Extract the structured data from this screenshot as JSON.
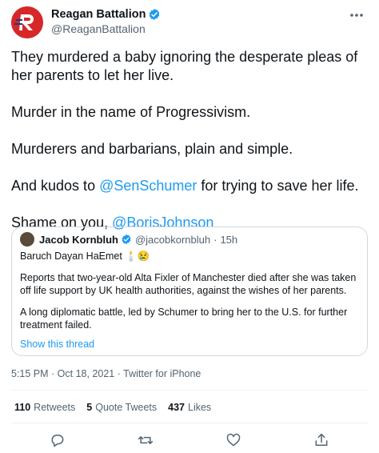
{
  "author": {
    "display_name": "Reagan Battalion",
    "handle": "@ReaganBattalion",
    "avatar_icon": "reagan-battalion-logo"
  },
  "tweet": {
    "p1": "They murdered a baby ignoring the desperate pleas of her parents to let her live.",
    "p2": "Murder in the name of Progressivism.",
    "p3": "Murderers and barbarians, plain and simple.",
    "p4_before": "And kudos to ",
    "p4_mention": "@SenSchumer",
    "p4_after": " for trying to save her life.",
    "p5_before": "Shame on you, ",
    "p5_mention": "@BorisJohnson"
  },
  "quote": {
    "display_name": "Jacob Kornbluh",
    "handle": "@jacobkornbluh",
    "separator": "·",
    "time": "15h",
    "line1": "Baruch Dayan HaEmet 🕯️😢",
    "para1": "Reports that two-year-old Alta Fixler of Manchester died after she was taken off life support by UK health authorities, against the wishes of her parents.",
    "para2": "A long diplomatic battle, led by Schumer to bring her to the U.S. for further treatment failed.",
    "show_thread": "Show this thread"
  },
  "meta": {
    "timestamp": "5:15 PM · Oct 18, 2021 · Twitter for iPhone"
  },
  "stats": {
    "retweets_count": "110",
    "retweets_label": "Retweets",
    "quotes_count": "5",
    "quotes_label": "Quote Tweets",
    "likes_count": "437",
    "likes_label": "Likes"
  },
  "actions": [
    "reply-icon",
    "retweet-icon",
    "like-icon",
    "share-icon"
  ],
  "colors": {
    "accent": "#1d9bf0",
    "text": "#0f1419",
    "secondary": "#536471",
    "border": "#cfd9de",
    "brand_red": "#d62828"
  }
}
